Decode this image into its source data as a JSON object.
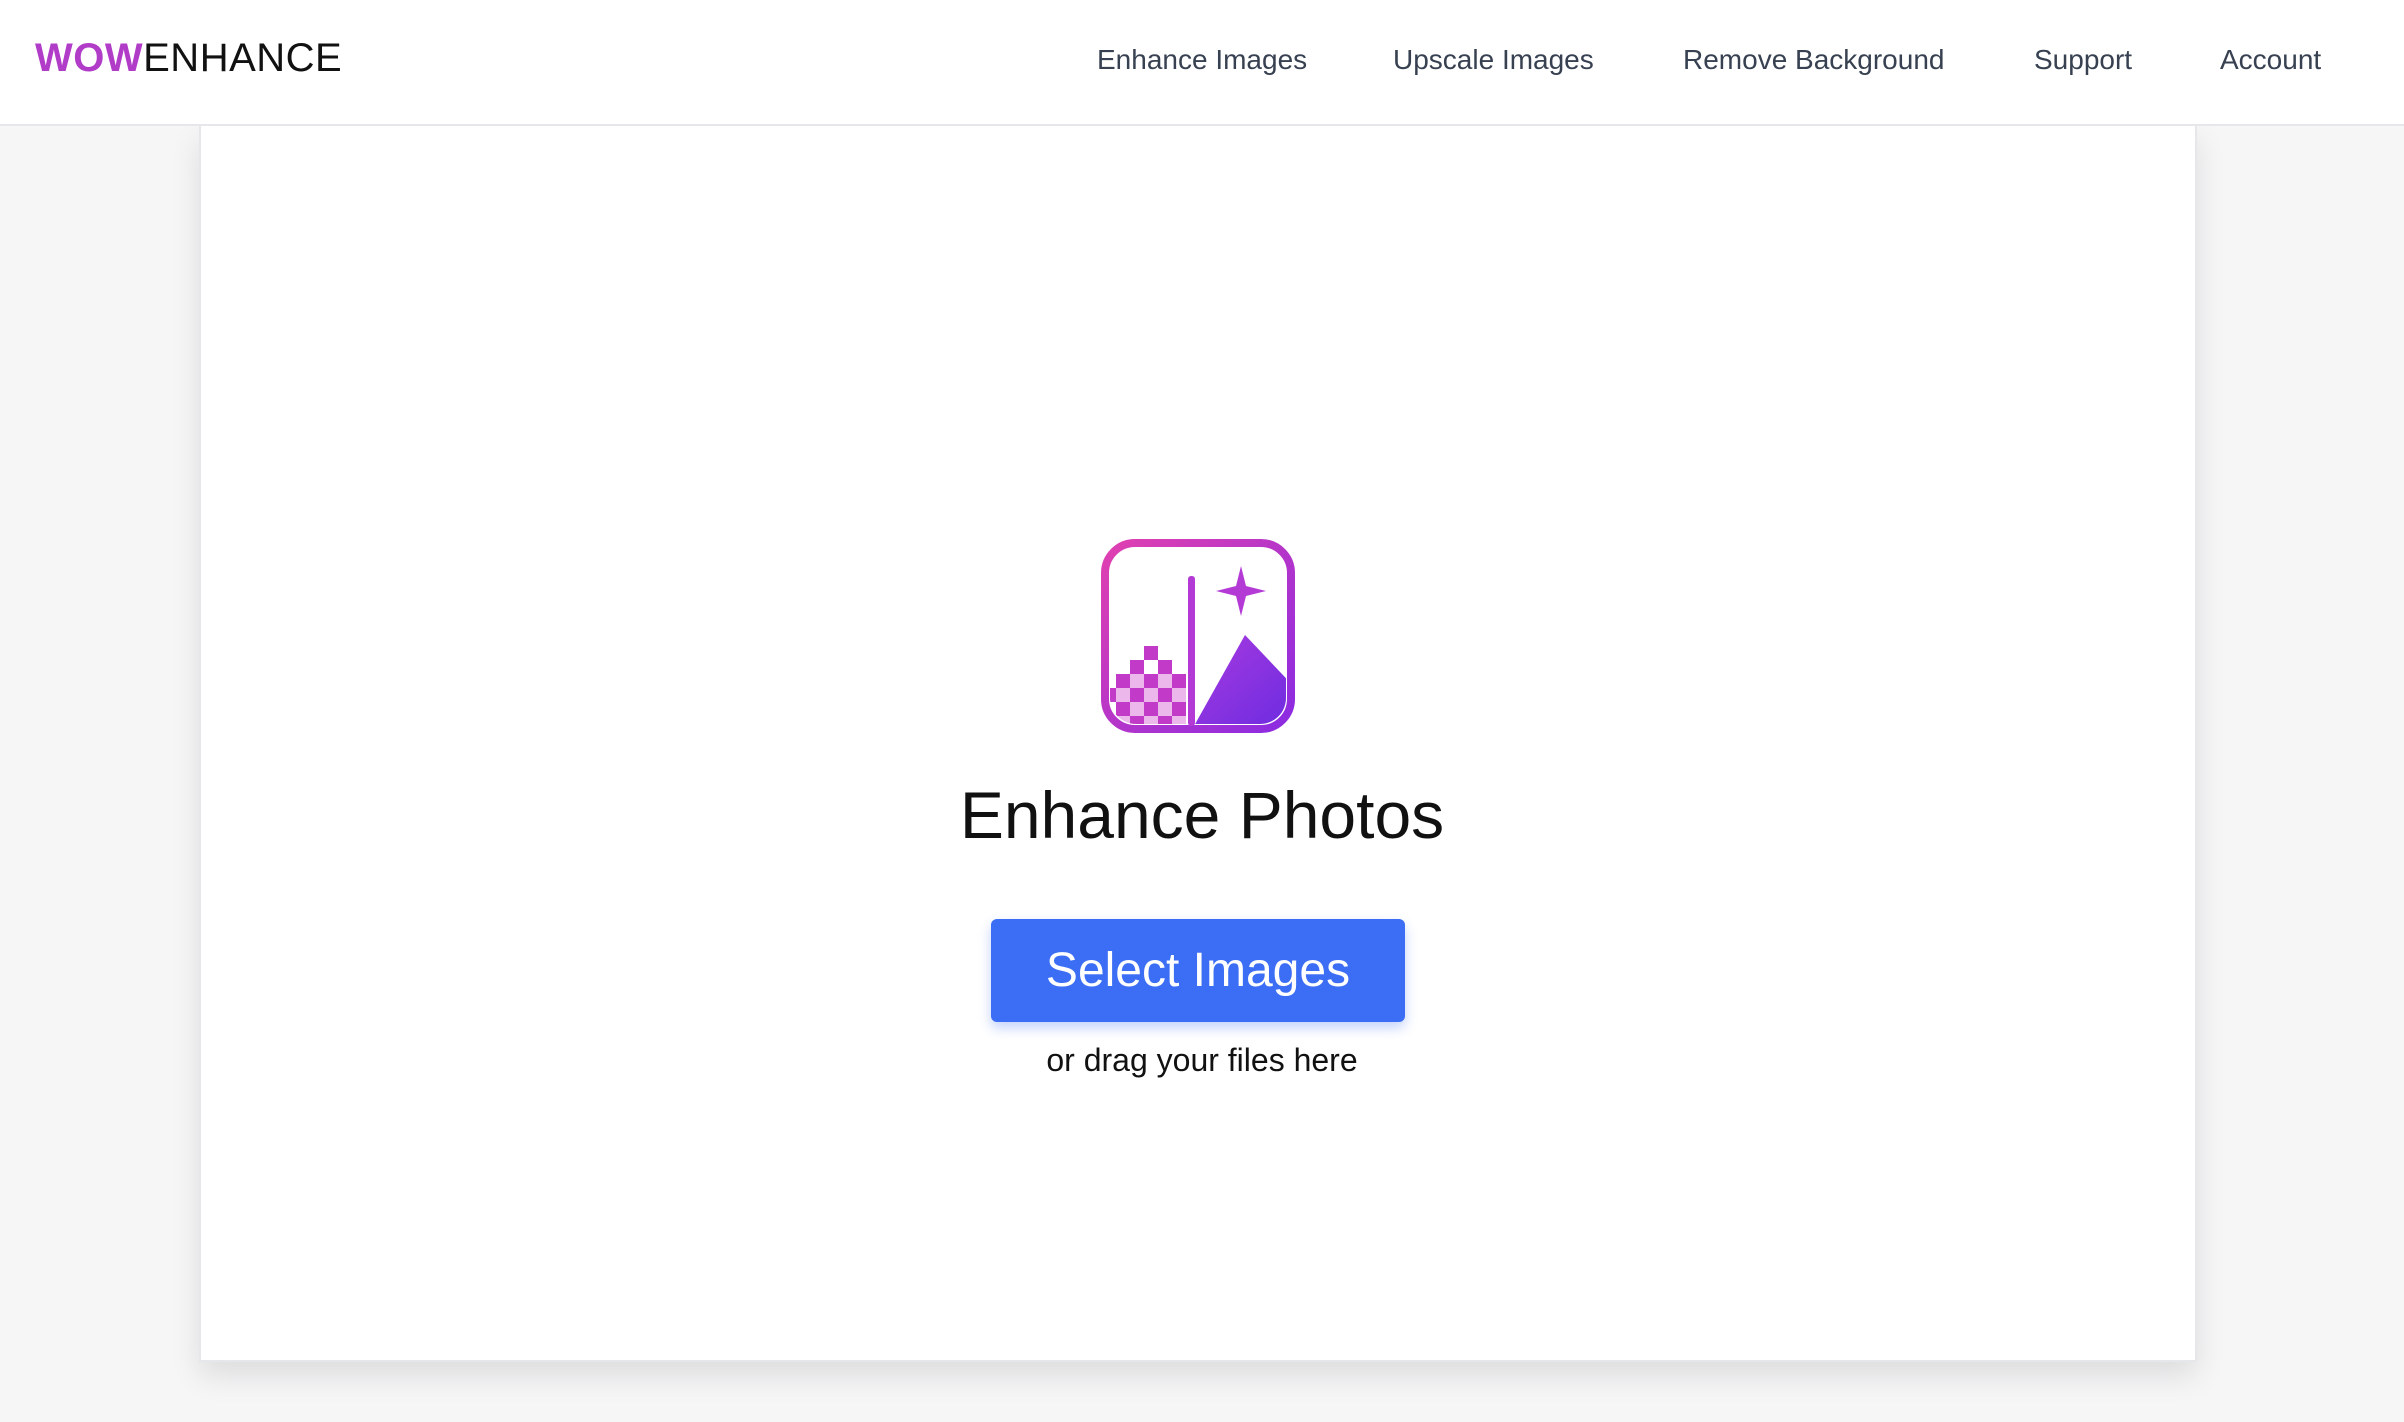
{
  "brand": {
    "logo_part1": "WOW",
    "logo_part2": "ENHANCE",
    "logo_accent_color": "#b03cc8"
  },
  "nav": {
    "enhance_images": "Enhance Images",
    "upscale_images": "Upscale Images",
    "remove_background": "Remove Background",
    "support": "Support",
    "account": "Account"
  },
  "upload": {
    "icon": "enhance-image-icon",
    "title": "Enhance Photos",
    "button_label": "Select Images",
    "drag_hint": "or drag your files here",
    "button_color": "#3b6ef5"
  }
}
